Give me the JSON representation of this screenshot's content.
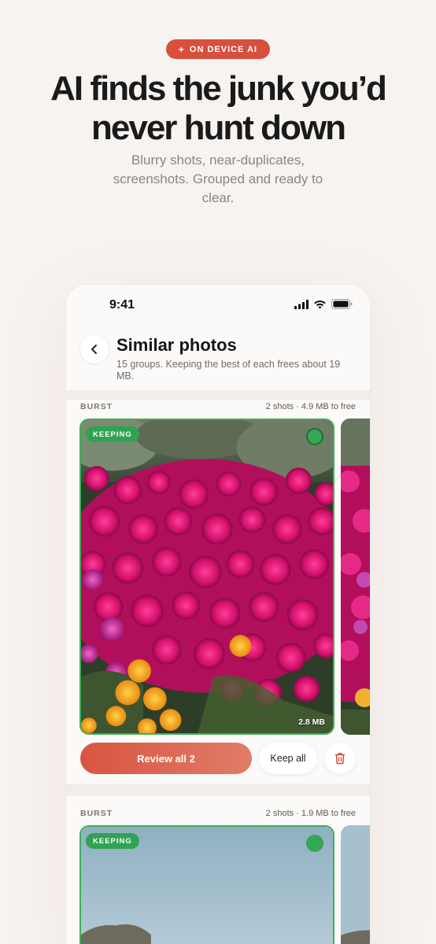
{
  "hero": {
    "badge_icon": "plus-icon",
    "badge_label": "ON DEVICE AI",
    "headline_line1": "AI finds the junk you’d",
    "headline_line2": "never hunt down",
    "subtitle": "Blurry shots, near-duplicates, screenshots. Grouped and ready to clear."
  },
  "status_bar": {
    "time": "9:41",
    "icons": [
      "signal-icon",
      "wifi-icon",
      "battery-icon"
    ]
  },
  "screen": {
    "back_icon": "chevron-left-icon",
    "title": "Similar photos",
    "subtitle": "15 groups. Keeping the best of each frees about 19 MB."
  },
  "groups": [
    {
      "label": "BURST",
      "info": "2 shots · 4.9 MB to free",
      "keeping_label": "KEEPING",
      "photo_size": "2.8 MB",
      "review_label": "Review all 2",
      "keep_all_label": "Keep all",
      "trash_icon": "trash-icon"
    },
    {
      "label": "BURST",
      "info": "2 shots · 1.9 MB to free",
      "keeping_label": "KEEPING"
    }
  ],
  "colors": {
    "accent": "#d6503d",
    "keeping_green": "#2fa352",
    "background": "#f6f3f0"
  }
}
